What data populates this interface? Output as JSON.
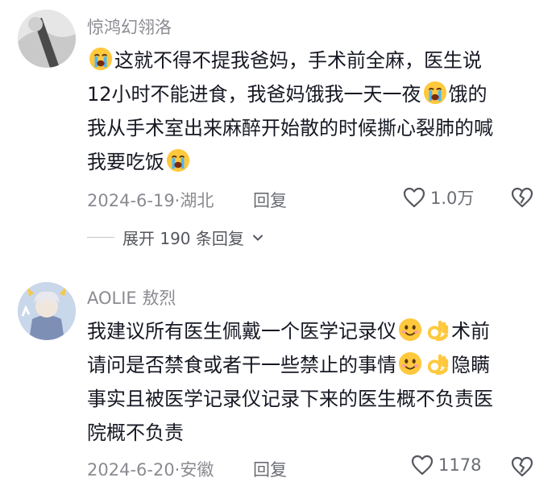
{
  "comments": [
    {
      "username": "惊鸿幻翎洛",
      "lines": [
        {
          "parts": [
            "",
            "这就不得不提我爸妈，手术前全麻，医生说"
          ]
        },
        {
          "parts": [
            "12小时不能进食，我爸妈饿我一天一夜",
            "饿的"
          ]
        },
        {
          "parts": [
            "我从手术室出来麻醉开始散的时候撕心裂肺的喊"
          ]
        },
        {
          "parts": [
            "我要吃饭",
            ""
          ]
        }
      ],
      "date_location": "2024-6-19·湖北",
      "reply_label": "回复",
      "like_count": "1.0万",
      "expand_label": "展开 190 条回复"
    },
    {
      "username": "AOLIE 敖烈",
      "lines": [
        {
          "parts": [
            "我建议所有医生佩戴一个医学记录仪",
            "",
            "术前"
          ]
        },
        {
          "parts": [
            "请问是否禁食或者干一些禁止的事情",
            "",
            "隐瞒"
          ]
        },
        {
          "parts": [
            "事实且被医学记录仪记录下来的医生概不负责医"
          ]
        },
        {
          "parts": [
            "院概不负责"
          ]
        }
      ],
      "date_location": "2024-6-20·安徽",
      "reply_label": "回复",
      "like_count": "1178"
    }
  ],
  "icons": {
    "crying_emoji": "loudly-crying-face",
    "smile_emoji": "smiling-face",
    "ok_emoji": "ok-hand",
    "like": "heart-outline",
    "dislike": "broken-heart-outline",
    "chevron": "chevron-down"
  },
  "colors": {
    "text": "#161823",
    "muted": "#8a8b91",
    "emoji_yellow": "#ffc83d"
  }
}
